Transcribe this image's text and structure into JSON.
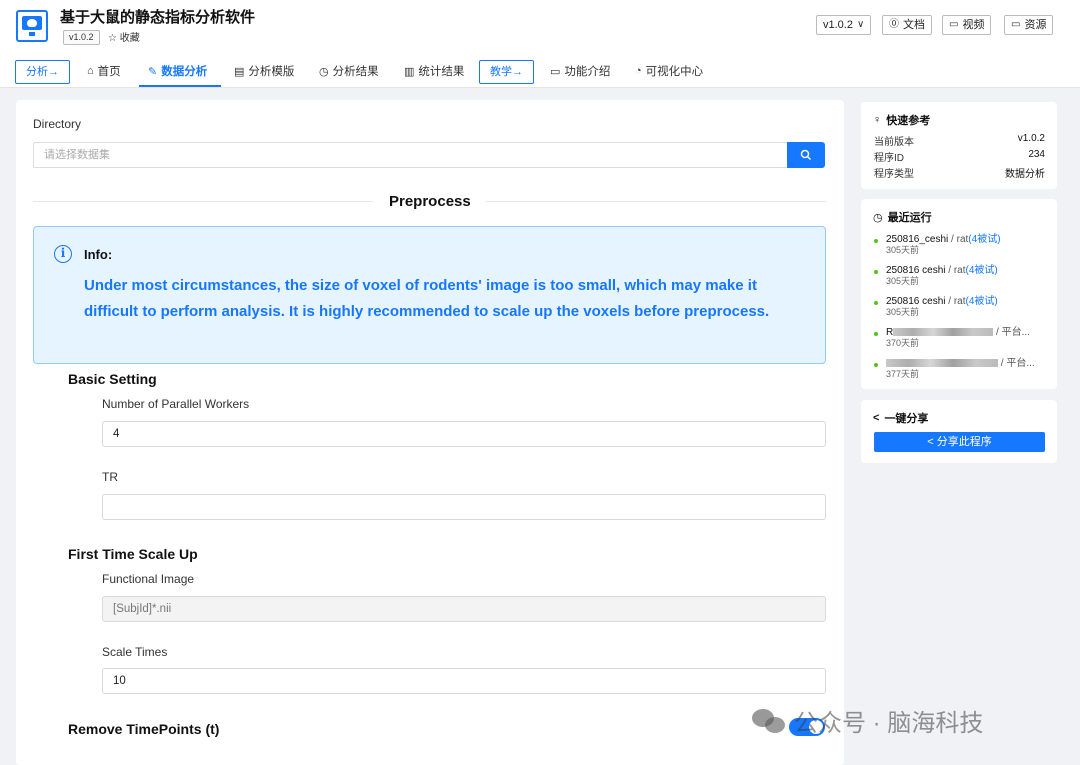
{
  "header": {
    "title": "基于大鼠的静态指标分析软件",
    "version_tag": "v1.0.2",
    "favorite": "☆ 收藏",
    "version_select": "v1.0.2",
    "docs": "文档",
    "video": "视频",
    "resources": "资源"
  },
  "nav": {
    "analysis_pill": "分析→",
    "home": "首页",
    "data_analysis": "数据分析",
    "template": "分析模版",
    "results": "分析结果",
    "stats": "统计结果",
    "teach_pill": "教学→",
    "features": "功能介绍",
    "viz": "可视化中心"
  },
  "main": {
    "directory_label": "Directory",
    "directory_placeholder": "请选择数据集",
    "section_title": "Preprocess",
    "info_title": "Info:",
    "info_message": "Under most circumstances, the size of voxel of rodents' image is too small, which may make it difficult to perform analysis. It is highly recommended to scale up the voxels before preprocess.",
    "basic_setting": "Basic Setting",
    "workers_label": "Number of Parallel Workers",
    "workers_value": "4",
    "tr_label": "TR",
    "tr_value": "",
    "scale_title": "First Time Scale Up",
    "func_label": "Functional Image",
    "func_value": "[SubjId]*.nii",
    "scale_label": "Scale Times",
    "scale_value": "10",
    "remove_title": "Remove TimePoints (t)",
    "remove_toggle_on": true
  },
  "sidebar": {
    "quick_ref": {
      "title": "快速参考",
      "rows": [
        {
          "k": "当前版本",
          "v": "v1.0.2"
        },
        {
          "k": "程序ID",
          "v": "234"
        },
        {
          "k": "程序类型",
          "v": "数据分析"
        }
      ]
    },
    "recent": {
      "title": "最近运行",
      "items": [
        {
          "name": "250816_ceshi",
          "sep": " / rat",
          "tag": "(4被试)",
          "ago": "305天前"
        },
        {
          "name": "250816 ceshi",
          "sep": " / rat",
          "tag": "(4被试)",
          "ago": "305天前"
        },
        {
          "name": "250816 ceshi",
          "sep": " / rat",
          "tag": "(4被试)",
          "ago": "305天前"
        },
        {
          "name": "R",
          "sep": " / 平台...",
          "tag": "",
          "ago": "370天前"
        },
        {
          "name": "",
          "sep": " / 平台...",
          "tag": "",
          "ago": "377天前"
        }
      ]
    },
    "share": {
      "title": "一键分享",
      "button": "分享此程序"
    }
  },
  "watermark": "公众号 · 脑海科技",
  "colors": {
    "accent": "#1677ff",
    "info_bg": "#e6f4ff",
    "status_green": "#52c41a"
  }
}
